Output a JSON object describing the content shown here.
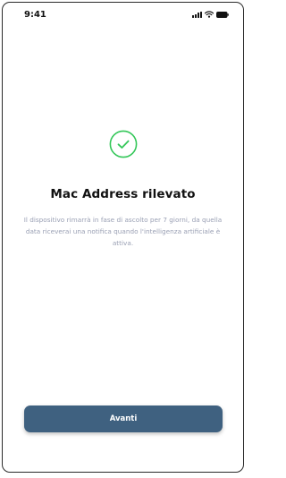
{
  "status_bar": {
    "time": "9:41",
    "icons": [
      "signal-icon",
      "wifi-icon",
      "battery-icon"
    ]
  },
  "success_icon": "check-circle-icon",
  "title": "Mac Address rilevato",
  "description": "Il dispositivo rimarrà in fase di ascolto per 7 giorni, da quella data riceverai una notifica quando l'intelligenza artificiale è attiva.",
  "continue_button": {
    "label": "Avanti"
  },
  "colors": {
    "success": "#34c759",
    "button": "#3f6180",
    "description": "#9aa0b4"
  }
}
